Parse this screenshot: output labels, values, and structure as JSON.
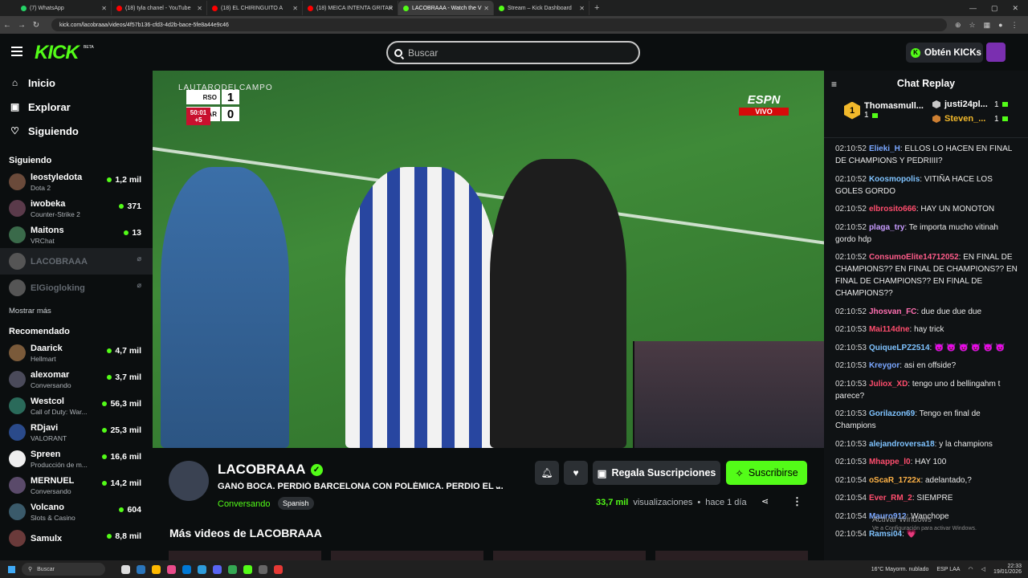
{
  "browser": {
    "tabs": [
      {
        "label": "(7) WhatsApp",
        "color": "#25d366"
      },
      {
        "label": "(18) tyla chanel - YouTube",
        "color": "#ff0000"
      },
      {
        "label": "(18) EL CHIRINGUITO A",
        "color": "#ff0000"
      },
      {
        "label": "(18) MEICA INTENTA GRITAR",
        "color": "#ff0000"
      },
      {
        "label": "LACOBRAAA - Watch the V",
        "color": "#53fc18"
      },
      {
        "label": "Stream – Kick Dashboard",
        "color": "#53fc18"
      }
    ],
    "url": "kick.com/lacobraaa/videos/4f57b136-cfd3-4d2b-bace-5fe8a44e9c46"
  },
  "header": {
    "logo": "KICK",
    "beta": "BETA",
    "search_placeholder": "Buscar",
    "get_kicks": "Obtén KICKs",
    "brand_color": "#53fc18"
  },
  "sidebar": {
    "nav": [
      {
        "label": "Inicio",
        "icon": "⌂"
      },
      {
        "label": "Explorar",
        "icon": "▣"
      },
      {
        "label": "Siguiendo",
        "icon": "♡"
      }
    ],
    "following_title": "Siguiendo",
    "following": [
      {
        "name": "leostyledota",
        "category": "Dota 2",
        "viewers": "1,2 mil",
        "color": "#6a4a3a"
      },
      {
        "name": "iwobeka",
        "category": "Counter-Strike 2",
        "viewers": "371",
        "color": "#5a3a4a"
      },
      {
        "name": "Maitons",
        "category": "VRChat",
        "viewers": "13",
        "color": "#3a6a4a"
      },
      {
        "name": "LACOBRAAA",
        "category": "",
        "viewers": "",
        "color": "#555"
      },
      {
        "name": "ElGiogloking",
        "category": "",
        "viewers": "",
        "color": "#555"
      }
    ],
    "show_more": "Mostrar más",
    "recommended_title": "Recomendado",
    "recommended": [
      {
        "name": "Daarick",
        "category": "Hellmart",
        "viewers": "4,7 mil",
        "color": "#7a5a3a"
      },
      {
        "name": "alexomar",
        "category": "Conversando",
        "viewers": "3,7 mil",
        "color": "#4a4a5a"
      },
      {
        "name": "Westcol",
        "category": "Call of Duty: War...",
        "viewers": "56,3 mil",
        "color": "#2a6a5a"
      },
      {
        "name": "RDjavi",
        "category": "VALORANT",
        "viewers": "25,3 mil",
        "color": "#2a4a8a"
      },
      {
        "name": "Spreen",
        "category": "Producción de m...",
        "viewers": "16,6 mil",
        "color": "#eee"
      },
      {
        "name": "MERNUEL",
        "category": "Conversando",
        "viewers": "14,2 mil",
        "color": "#5a4a6a"
      },
      {
        "name": "Volcano",
        "category": "Slots & Casino",
        "viewers": "604",
        "color": "#3a5a6a"
      },
      {
        "name": "Samulx",
        "category": "",
        "viewers": "8,8 mil",
        "color": "#6a3a3a"
      }
    ]
  },
  "player": {
    "watermark": "LAUTARODELCAMPO",
    "home_team": "RSO",
    "away_team": "BAR",
    "home_score": "1",
    "away_score": "0",
    "clock": "50:01",
    "added": "+5",
    "broadcaster": "ESPN",
    "live": "VIVO"
  },
  "channel": {
    "name": "LACOBRAAA",
    "title": "GANÓ BOCA. PERDIÓ BARCELONA CON POLÉMICA. PERDIO EL ...",
    "category": "Conversando",
    "language": "Spanish",
    "gift_label": "Regala Suscripciones",
    "subscribe_label": "Suscribirse",
    "views": "33,7 mil",
    "views_label": "visualizaciones",
    "time_ago": "hace 1 día",
    "more_videos": "Más videos de LACOBRAAA"
  },
  "chat": {
    "title": "Chat Replay",
    "leaders": [
      {
        "rank": "1",
        "name": "Thomasmull...",
        "count": "1"
      },
      {
        "name": "justi24pl...",
        "count": "1",
        "color": "#c8c8c8"
      },
      {
        "name": "Steven_...",
        "count": "1",
        "color": "#cd7f32"
      }
    ],
    "messages": [
      {
        "time": "02:10:52",
        "user": "Elieki_H",
        "color": "#7aa7ff",
        "text": ": ELLOS LO HACEN EN FINAL DE CHAMPIONS Y PEDRIIII?"
      },
      {
        "time": "02:10:52",
        "user": "Koosmopolis",
        "color": "#7fc3ff",
        "text": ": VITIÑA HACE LOS GOLES GORDO"
      },
      {
        "time": "02:10:52",
        "user": "elbrosito666",
        "color": "#ff4d6d",
        "text": ": HAY UN MONOTON"
      },
      {
        "time": "02:10:52",
        "user": "plaga_try",
        "color": "#c89cff",
        "text": ": Te importa mucho vitinah gordo hdp"
      },
      {
        "time": "02:10:52",
        "user": "ConsumoElite14712052",
        "color": "#ff5c8a",
        "text": ": EN FINAL DE CHAMPIONS?? EN FINAL DE CHAMPIONS?? EN FINAL DE CHAMPIONS?? EN FINAL DE CHAMPIONS??"
      },
      {
        "time": "02:10:52",
        "user": "Jhosvan_FC",
        "color": "#ff6fb0",
        "text": ": due due due due"
      },
      {
        "time": "02:10:53",
        "user": "Mai114dne",
        "color": "#ff4d6d",
        "text": ": hay trick"
      },
      {
        "time": "02:10:53",
        "user": "QuiqueLPZ2514",
        "color": "#7fc3ff",
        "text": ": 😈 😈 😈 😈 😈 😈"
      },
      {
        "time": "02:10:53",
        "user": "Kreygor",
        "color": "#7aa7ff",
        "text": ": asi en offside?"
      },
      {
        "time": "02:10:53",
        "user": "Juliox_XD",
        "color": "#ff4d6d",
        "text": ": tengo uno d bellingahm t parece?"
      },
      {
        "time": "02:10:53",
        "user": "Gorilazon69",
        "color": "#7fc3ff",
        "text": ": Tengo en final de Champions"
      },
      {
        "time": "02:10:53",
        "user": "alejandroversa18",
        "color": "#7fc3ff",
        "text": ": y la champions"
      },
      {
        "time": "02:10:53",
        "user": "Mhappe_l0",
        "color": "#ff4d6d",
        "text": ": HAY 100"
      },
      {
        "time": "02:10:54",
        "user": "oScaR_1722x",
        "color": "#ffb347",
        "text": ": adelantado,?"
      },
      {
        "time": "02:10:54",
        "user": "Ever_RM_2",
        "color": "#ff4d6d",
        "text": ": SIEMPRE"
      },
      {
        "time": "02:10:54",
        "user": "Mauro912",
        "color": "#7aa7ff",
        "text": ": Wanchope"
      },
      {
        "time": "02:10:54",
        "user": "Ramsi04",
        "color": "#7fc3ff",
        "text": ": 💗"
      }
    ]
  },
  "os": {
    "activate_windows": "Activar Windows",
    "activate_sub": "Ve a Configuración para activar Windows.",
    "taskbar_search": "Buscar",
    "weather": "16°C Mayorm. nublado",
    "lang": "ESP LAA",
    "time": "22:33",
    "date": "19/01/2026"
  }
}
